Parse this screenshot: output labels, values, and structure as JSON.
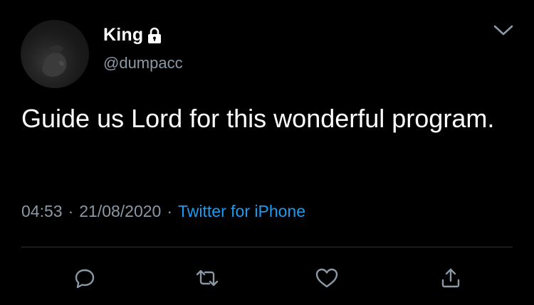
{
  "tweet": {
    "author": {
      "name": "King",
      "handle": "@dumpacc",
      "protected_icon": "lock-icon"
    },
    "menu_icon": "chevron-down-icon",
    "text": "Guide us Lord for this wonderful program.",
    "meta": {
      "time": "04:53",
      "separator": "·",
      "date": "21/08/2020",
      "source": "Twitter for iPhone"
    },
    "actions": [
      {
        "icon": "reply-icon"
      },
      {
        "icon": "retweet-icon"
      },
      {
        "icon": "like-icon"
      },
      {
        "icon": "share-icon"
      }
    ]
  },
  "colors": {
    "background": "#000000",
    "text_primary": "#ffffff",
    "text_secondary": "#8b98a5",
    "link": "#1d9bf0",
    "divider": "#2f3336"
  }
}
